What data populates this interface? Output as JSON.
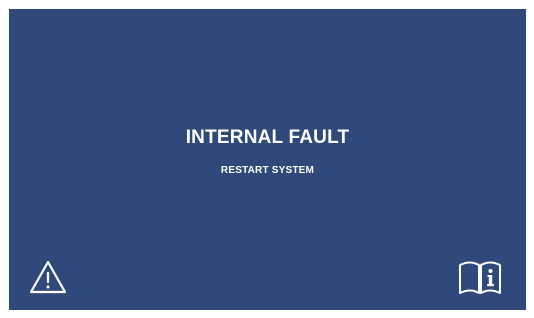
{
  "screen": {
    "background_color": "#2f4a7a",
    "text_color": "#ffffff"
  },
  "message": {
    "title": "INTERNAL FAULT",
    "subtitle": "RESTART SYSTEM"
  },
  "icons": {
    "left": "warning-triangle-icon",
    "right": "manual-info-book-icon"
  }
}
